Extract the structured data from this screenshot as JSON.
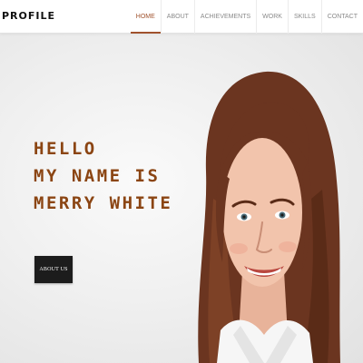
{
  "header": {
    "logo": "PROFILE",
    "nav": [
      {
        "label": "HOME",
        "active": true
      },
      {
        "label": "ABOUT",
        "active": false
      },
      {
        "label": "ACHIEVEMENTS",
        "active": false
      },
      {
        "label": "WORK",
        "active": false
      },
      {
        "label": "SKILLS",
        "active": false
      },
      {
        "label": "CONTACT",
        "active": false
      }
    ]
  },
  "hero": {
    "line1": "HELLO",
    "line2": "MY NAME IS",
    "line3": "MERRY WHITE",
    "button_label": "ABOUT US",
    "portrait_icon": "woman-portrait"
  },
  "colors": {
    "accent": "#8b4513",
    "nav_active": "#a0522d",
    "button_bg": "#1c1c1c"
  }
}
